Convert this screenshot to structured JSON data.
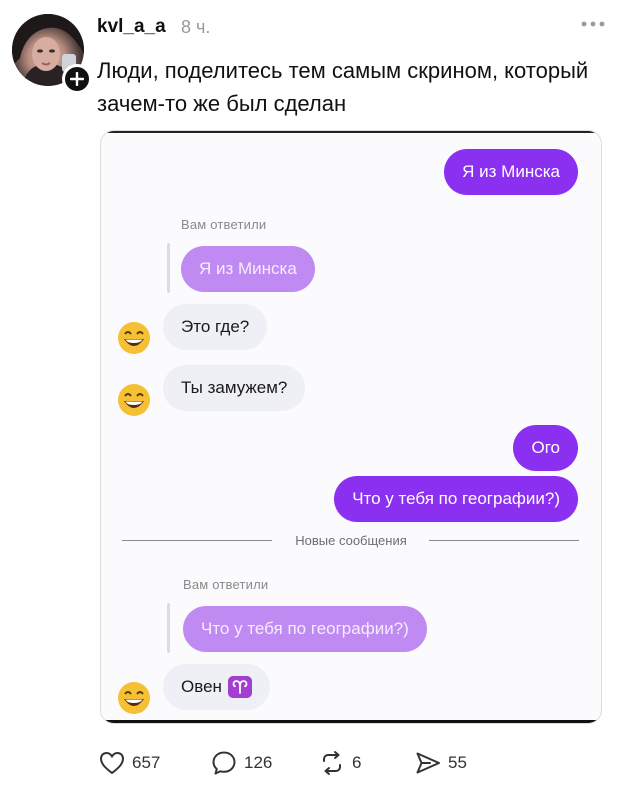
{
  "post": {
    "author": "kvl_a_a",
    "time": "8 ч.",
    "text": "Люди, поделитесь тем самым скрином, который зачем-то же был сделан",
    "avatar_icon": "user-avatar-photo",
    "follow_icon": "plus-icon",
    "more_icon": "more-horizontal-icon"
  },
  "chat": {
    "msg_out_1": "Я из Минска",
    "reply_label_1": "Вам ответили",
    "quoted_1": "Я из Минска",
    "msg_in_1": "Это где?",
    "msg_in_2": "Ты замужем?",
    "msg_out_2": "Ого",
    "msg_out_3": "Что у тебя по географии?)",
    "new_messages_divider": "Новые сообщения",
    "reply_label_2": "Вам ответили",
    "quoted_2": "Что у тебя по географии?)",
    "msg_in_3": "Овен",
    "zodiac_icon": "aries-sign-icon",
    "sender_emoji": "grinning-face-emoji"
  },
  "actions": {
    "likes": "657",
    "comments": "126",
    "reposts": "6",
    "shares": "55"
  },
  "colors": {
    "outgoing_bubble": "#8b2ff0",
    "quoted_bubble": "#c08af3",
    "incoming_bubble": "#eff0f5",
    "zodiac_badge": "#a23ed0"
  }
}
